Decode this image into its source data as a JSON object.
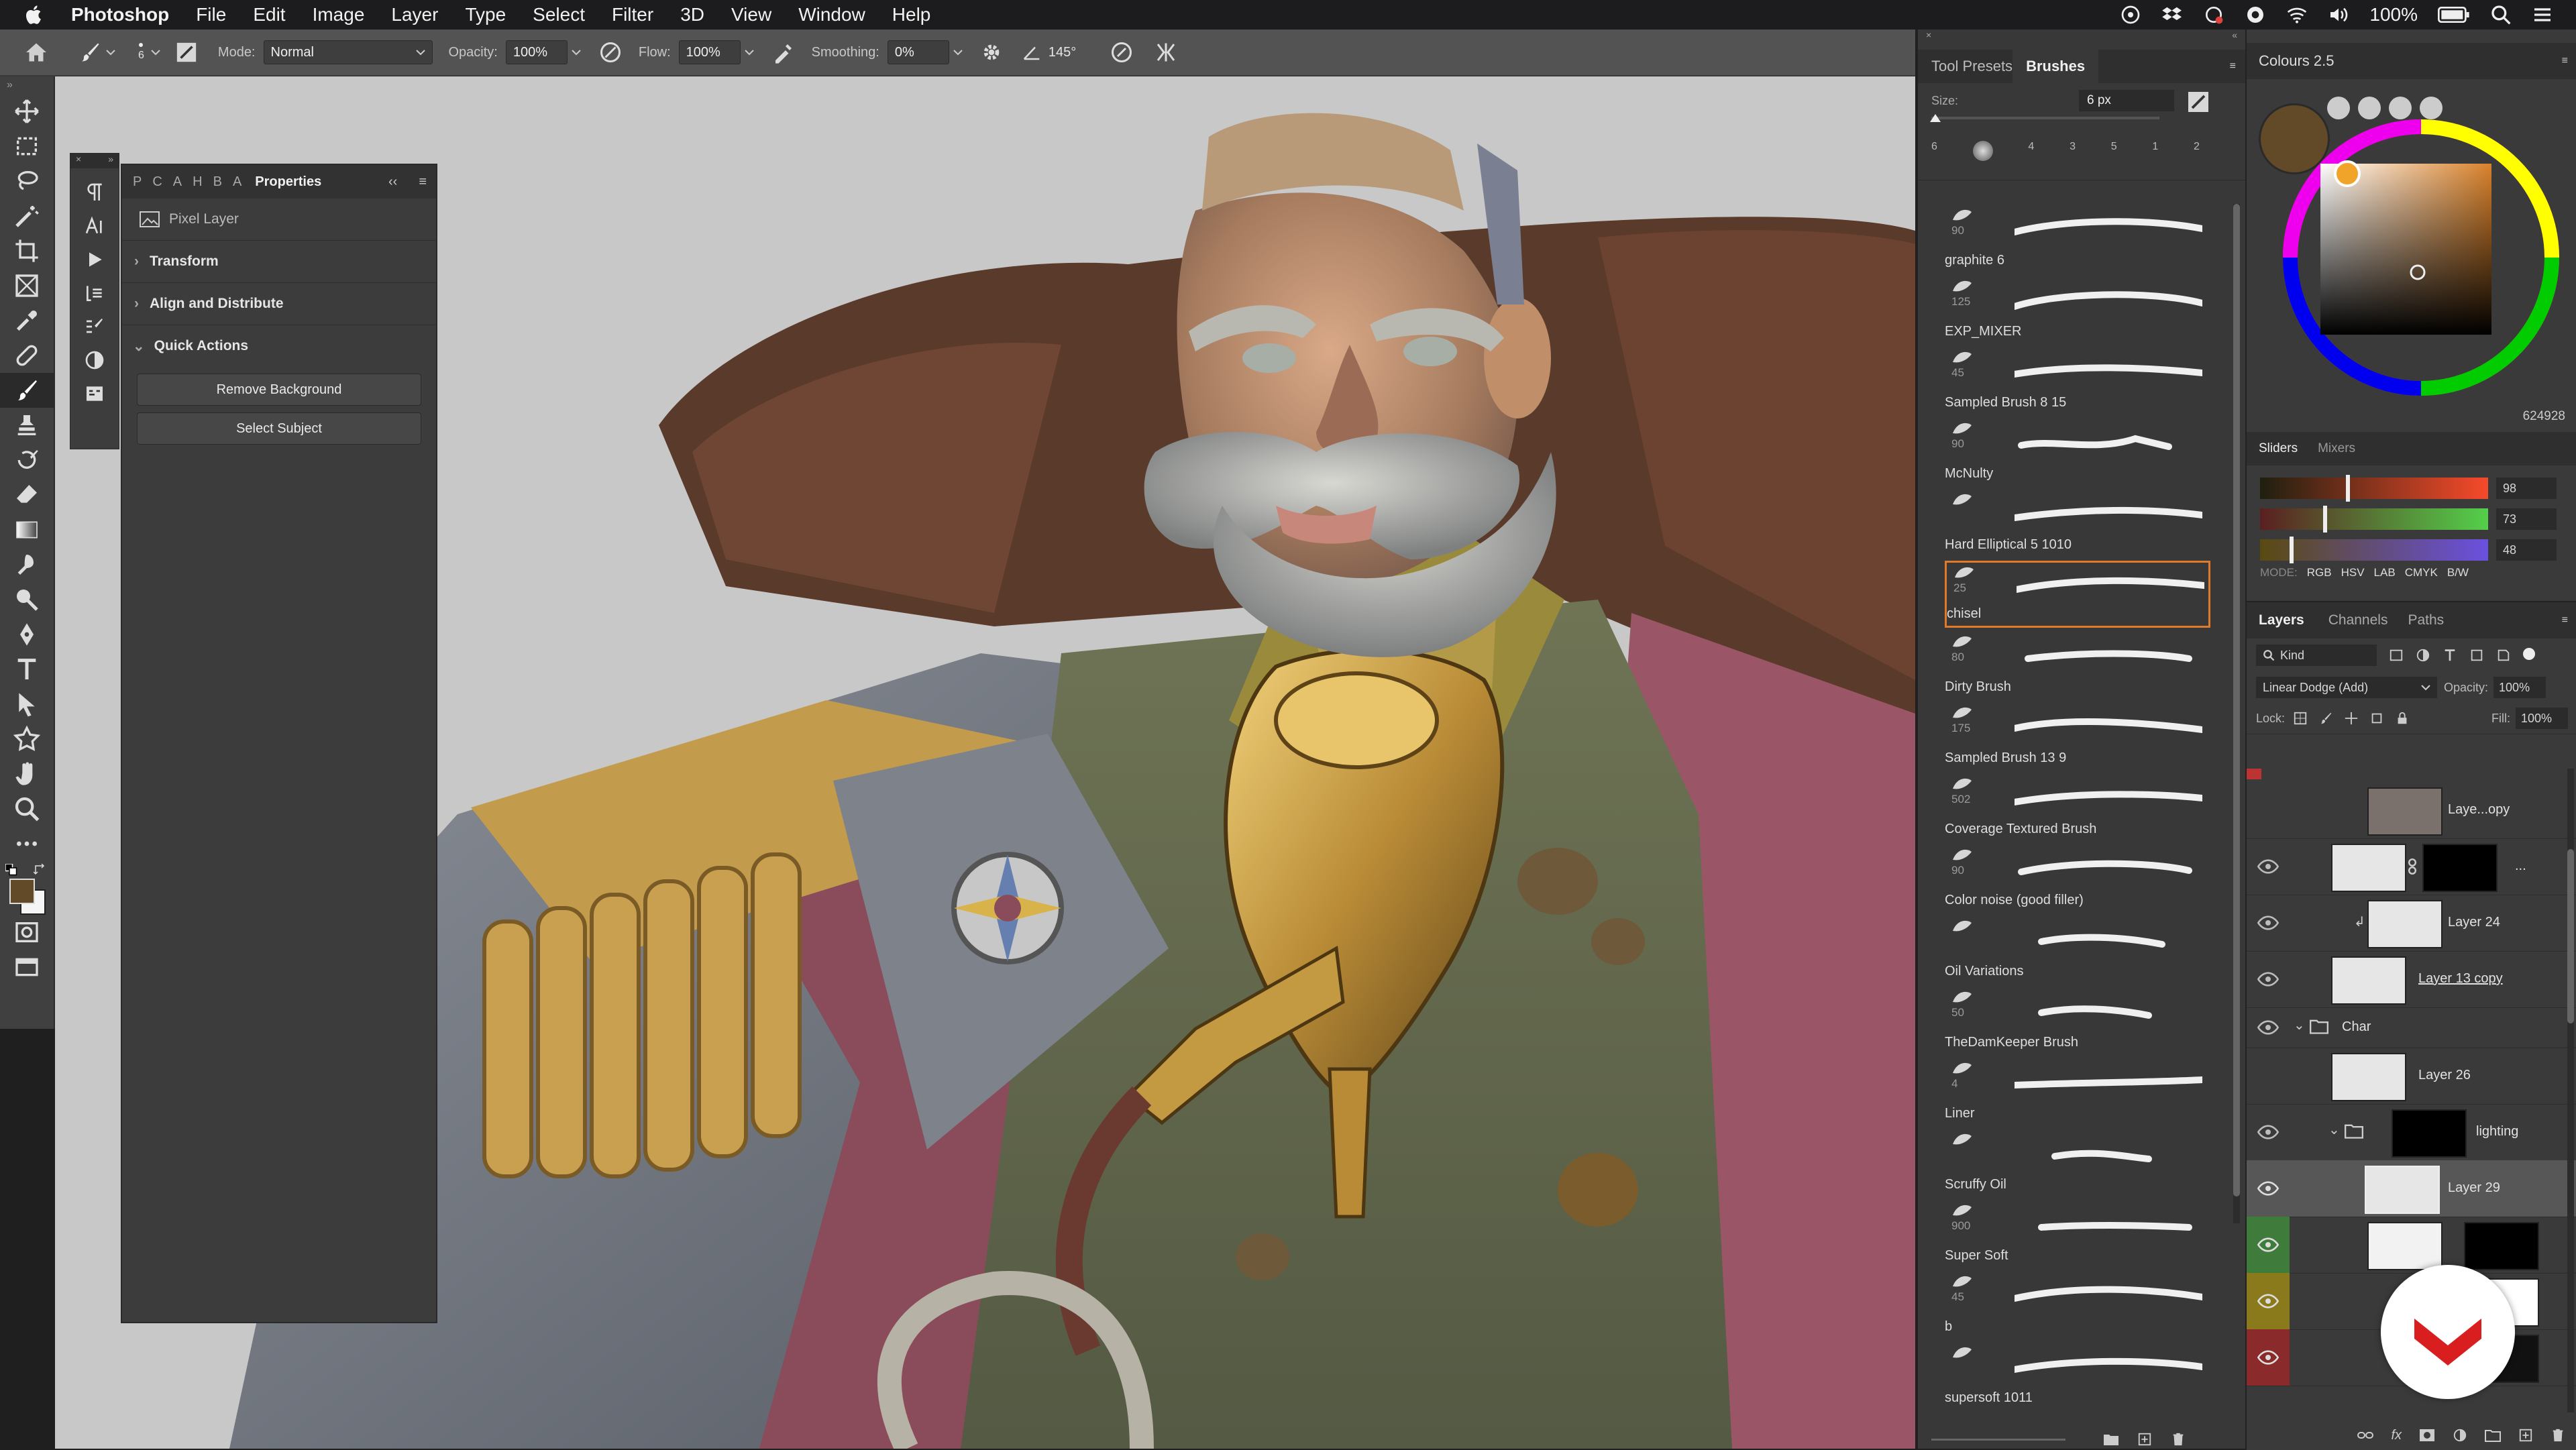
{
  "menubar": {
    "app": "Photoshop",
    "items": [
      "File",
      "Edit",
      "Image",
      "Layer",
      "Type",
      "Select",
      "Filter",
      "3D",
      "View",
      "Window",
      "Help"
    ],
    "battery": "100%"
  },
  "options": {
    "brush_size": "6",
    "mode_label": "Mode:",
    "mode_value": "Normal",
    "opacity_label": "Opacity:",
    "opacity_value": "100%",
    "flow_label": "Flow:",
    "flow_value": "100%",
    "smoothing_label": "Smoothing:",
    "smoothing_value": "0%",
    "angle_value": "145°"
  },
  "properties": {
    "tabs": [
      "P",
      "C",
      "A",
      "H",
      "B",
      "A"
    ],
    "active_tab": "Properties",
    "layer_type": "Pixel Layer",
    "sections": [
      "Transform",
      "Align and Distribute",
      "Quick Actions"
    ],
    "buttons": [
      "Remove Background",
      "Select Subject"
    ]
  },
  "brushes": {
    "tabs": [
      "Tool Presets",
      "Brushes"
    ],
    "size_label": "Size:",
    "size_value": "6 px",
    "recent_sizes": [
      "6",
      "",
      "4",
      "3",
      "5",
      "1",
      "2"
    ],
    "items": [
      {
        "name": "graphite 6",
        "size": "90"
      },
      {
        "name": "EXP_MIXER",
        "size": "125"
      },
      {
        "name": "Sampled Brush 8 15",
        "size": "45"
      },
      {
        "name": "McNulty",
        "size": "90"
      },
      {
        "name": "Hard Elliptical 5 1010",
        "size": ""
      },
      {
        "name": "chisel",
        "size": "25"
      },
      {
        "name": "Dirty Brush",
        "size": "80"
      },
      {
        "name": "Sampled Brush 13 9",
        "size": "175"
      },
      {
        "name": "Coverage Textured Brush",
        "size": "502"
      },
      {
        "name": "Color noise (good filler)",
        "size": "90"
      },
      {
        "name": "Oil Variations",
        "size": ""
      },
      {
        "name": "TheDamKeeper Brush",
        "size": "50"
      },
      {
        "name": "Liner",
        "size": "4"
      },
      {
        "name": "Scruffy Oil",
        "size": ""
      },
      {
        "name": "Super Soft",
        "size": "900"
      },
      {
        "name": "b",
        "size": "45"
      },
      {
        "name": "supersoft 1011",
        "size": ""
      }
    ],
    "selected_index": 5,
    "accent_color": "#e07a2b"
  },
  "colours": {
    "title": "Colours 2.5",
    "hex": "624928",
    "tabs": [
      "Sliders",
      "Mixers"
    ],
    "sliders": [
      {
        "channel": "R",
        "value": "98"
      },
      {
        "channel": "G",
        "value": "73"
      },
      {
        "channel": "B",
        "value": "48"
      }
    ],
    "modes": [
      "MODE:",
      "RGB",
      "HSV",
      "LAB",
      "CMYK",
      "B/W"
    ],
    "current_color": "#624928"
  },
  "layers": {
    "tabs": [
      "Layers",
      "Channels",
      "Paths"
    ],
    "filter": "Kind",
    "blend_mode": "Linear Dodge (Add)",
    "opacity_label": "Opacity:",
    "opacity_value": "100%",
    "lock_label": "Lock:",
    "fill_label": "Fill:",
    "fill_value": "100%",
    "rows": [
      {
        "name": "Laye...opy"
      },
      {
        "name": "..."
      },
      {
        "name": "Layer 24"
      },
      {
        "name": "Layer 13 copy"
      },
      {
        "name": "Char"
      },
      {
        "name": "Layer 26"
      },
      {
        "name": "lighting"
      },
      {
        "name": "Layer 29"
      },
      {
        "name": ""
      },
      {
        "name": ""
      },
      {
        "name": ""
      }
    ]
  }
}
